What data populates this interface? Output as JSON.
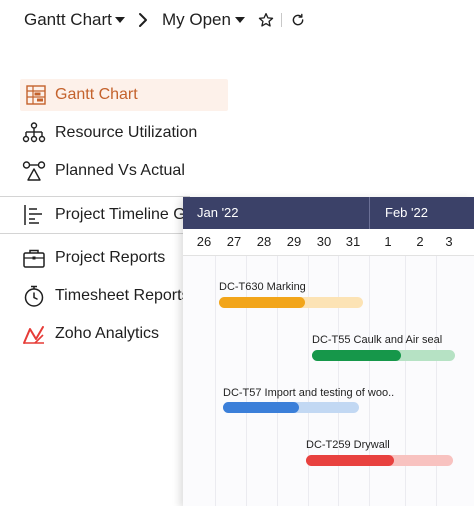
{
  "header": {
    "breadcrumb_root": "Gantt Chart",
    "view_name": "My Open"
  },
  "menu": {
    "items": [
      {
        "label": "Gantt Chart",
        "icon": "gantt-chart-icon",
        "active": true
      },
      {
        "label": "Resource Utilization",
        "icon": "resource-utilization-icon",
        "active": false
      },
      {
        "label": "Planned Vs Actual",
        "icon": "planned-vs-actual-icon",
        "active": false
      },
      {
        "label": "Project Timeline Gantt",
        "icon": "project-timeline-icon",
        "active": false
      },
      {
        "label": "Project Reports",
        "icon": "briefcase-icon",
        "active": false
      },
      {
        "label": "Timesheet Reports",
        "icon": "stopwatch-icon",
        "active": false
      },
      {
        "label": "Zoho Analytics",
        "icon": "analytics-icon",
        "active": false
      }
    ],
    "active_color": "#c4622c",
    "active_bg": "#fdf1ea"
  },
  "gantt": {
    "months": [
      "Jan '22",
      "Feb '22"
    ],
    "days": [
      "26",
      "27",
      "28",
      "29",
      "30",
      "31",
      "1",
      "2",
      "3"
    ],
    "header_color": "#3b4168",
    "tasks": [
      {
        "label": "DC-T630 Marking",
        "color": "#f2a51a",
        "light_color": "#fce3b5",
        "start_day": "27",
        "end_day": "31",
        "progress": 0.6
      },
      {
        "label": "DC-T55 Caulk and Air seal",
        "color": "#16974a",
        "light_color": "#b6e2c4",
        "start_day": "30",
        "end_day": "3",
        "progress": 0.62
      },
      {
        "label": "DC-T57 Import and testing of woo..",
        "color": "#3b7fd9",
        "light_color": "#c2d8f3",
        "start_day": "27",
        "end_day": "31",
        "progress": 0.56
      },
      {
        "label": "DC-T259 Drywall",
        "color": "#e8413f",
        "light_color": "#f8c2c0",
        "start_day": "30",
        "end_day": "2",
        "progress": 0.6
      }
    ]
  }
}
